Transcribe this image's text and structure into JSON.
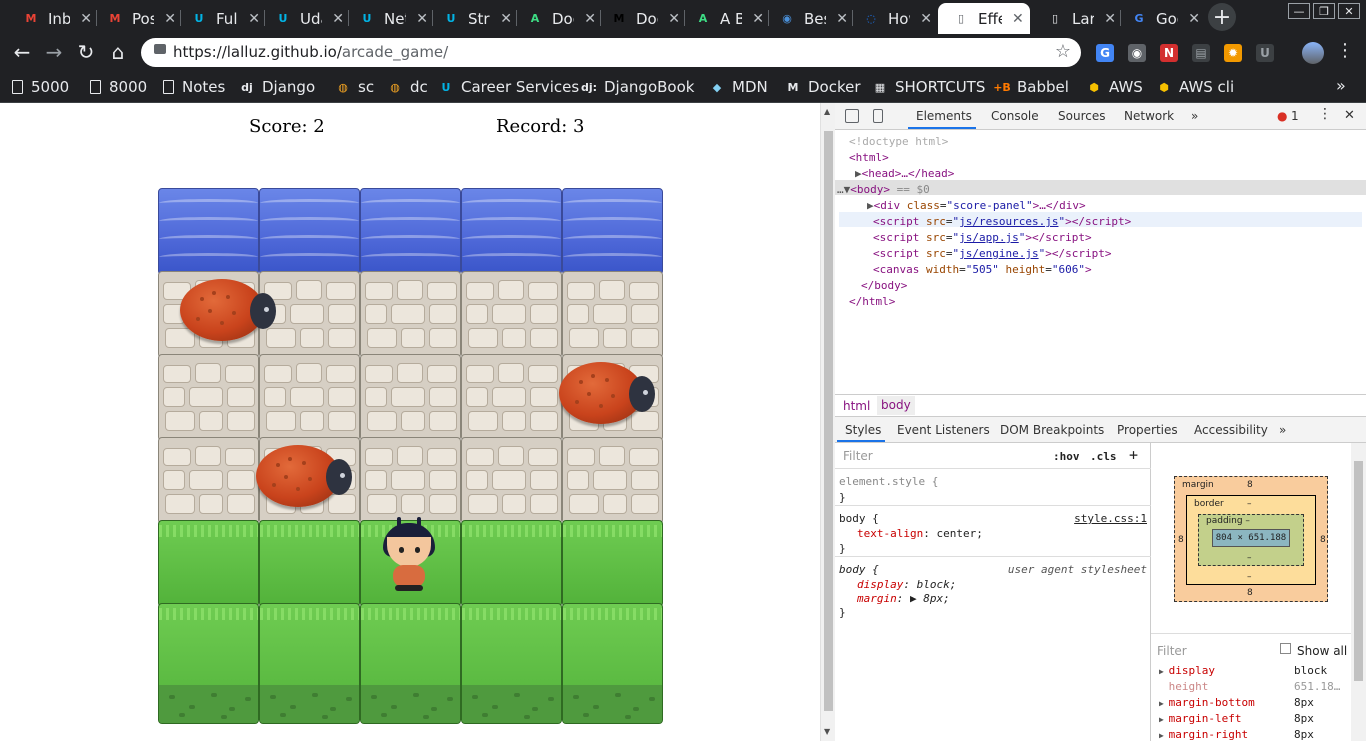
{
  "tabs": [
    {
      "title": "Inbox",
      "icon": "gmail-icon",
      "color": "#ea4335",
      "glyph": "M"
    },
    {
      "title": "Posts",
      "icon": "gmail-icon",
      "color": "#ea4335",
      "glyph": "M"
    },
    {
      "title": "Full",
      "icon": "udacity-icon",
      "color": "#02b3e4",
      "glyph": "U"
    },
    {
      "title": "Udacity",
      "icon": "udacity-icon",
      "color": "#02b3e4",
      "glyph": "U"
    },
    {
      "title": "Net",
      "icon": "udacity-icon",
      "color": "#02b3e4",
      "glyph": "U"
    },
    {
      "title": "Structure",
      "icon": "udacity-icon",
      "color": "#02b3e4",
      "glyph": "U"
    },
    {
      "title": "Docs",
      "icon": "android-icon",
      "color": "#3ddc84",
      "glyph": "A"
    },
    {
      "title": "Docker",
      "icon": "medium-icon",
      "color": "#000000",
      "glyph": "M"
    },
    {
      "title": "A B",
      "icon": "android-icon",
      "color": "#3ddc84",
      "glyph": "A"
    },
    {
      "title": "Best",
      "icon": "globe-icon",
      "color": "#4a90d9",
      "glyph": "◉"
    },
    {
      "title": "How",
      "icon": "loader-icon",
      "color": "#1a73e8",
      "glyph": "◌"
    },
    {
      "title": "Effective",
      "icon": "document-icon",
      "color": "#5f6368",
      "glyph": "▯"
    },
    {
      "title": "Large",
      "icon": "document-icon",
      "color": "#e8eaed",
      "glyph": "▯"
    },
    {
      "title": "Google",
      "icon": "google-icon",
      "color": "#4285f4",
      "glyph": "G"
    }
  ],
  "new_tab_glyph": "+",
  "window": {
    "minimize": "—",
    "maximize": "❐",
    "close": "✕"
  },
  "omnibox": {
    "host": "https://lalluz.github.io/",
    "path": "arcade_game/"
  },
  "bookmarks": [
    {
      "label": "5000",
      "icon": "page-icon"
    },
    {
      "label": "8000",
      "icon": "page-icon"
    },
    {
      "label": "Notes",
      "icon": "page-icon"
    },
    {
      "label": "Django",
      "icon": "django-icon",
      "glyph": "dj"
    },
    {
      "label": "sc",
      "icon": "sc-icon",
      "glyph": "◍"
    },
    {
      "label": "dc",
      "icon": "dc-icon",
      "glyph": "◍"
    },
    {
      "label": "Career Services",
      "icon": "udacity-icon",
      "glyph": "U"
    },
    {
      "label": "DjangoBook",
      "icon": "djangobook-icon",
      "glyph": "dj:"
    },
    {
      "label": "MDN",
      "icon": "mdn-icon",
      "glyph": "◆"
    },
    {
      "label": "Docker",
      "icon": "medium-icon",
      "glyph": "M"
    },
    {
      "label": "SHORTCUTS",
      "icon": "grid-icon",
      "glyph": "▦"
    },
    {
      "label": "Babbel",
      "icon": "babbel-icon",
      "glyph": "+B"
    },
    {
      "label": "AWS",
      "icon": "aws-icon",
      "glyph": "⬢"
    },
    {
      "label": "AWS cli",
      "icon": "aws-icon",
      "glyph": "⬢"
    }
  ],
  "game": {
    "score_label": "Score: 2",
    "record_label": "Record: 3",
    "rows": [
      "water",
      "stone",
      "stone",
      "stone",
      "grass",
      "grass"
    ],
    "enemies": [
      {
        "row": 1,
        "col": 0.2
      },
      {
        "row": 2,
        "col": 3.95
      },
      {
        "row": 3,
        "col": 0.95
      }
    ],
    "player": {
      "row": 4,
      "col": 2
    }
  },
  "devtools": {
    "tabs": [
      "Elements",
      "Console",
      "Sources",
      "Network"
    ],
    "more": "»",
    "error_count": "1",
    "close": "✕",
    "kebab": "⋮",
    "dom": {
      "doctype": "<!doctype html>",
      "html_open": "<html>",
      "head": "<head>…</head>",
      "body_open": "<body>",
      "body_marker": "== $0",
      "div_class": "score-panel",
      "scripts": [
        "js/resources.js",
        "js/app.js",
        "js/engine.js"
      ],
      "canvas_width": "505",
      "canvas_height": "606",
      "body_close": "</body>",
      "html_close": "</html>"
    },
    "breadcrumbs": [
      "html",
      "body"
    ],
    "subtabs": [
      "Styles",
      "Event Listeners",
      "DOM Breakpoints",
      "Properties",
      "Accessibility",
      "»"
    ],
    "filter_placeholder": "Filter",
    "hov": ":hov",
    "cls": ".cls",
    "plus": "+",
    "rules": {
      "element_style": "element.style {",
      "close_brace": "}",
      "body1_selector": "body {",
      "body1_source": "style.css:1",
      "body1_prop": "text-align",
      "body1_val": "center;",
      "body2_selector": "body {",
      "body2_source": "user agent stylesheet",
      "body2_prop1": "display",
      "body2_val1": "block;",
      "body2_prop2": "margin",
      "body2_val2": "8px;"
    },
    "box_model": {
      "margin_label": "margin",
      "margin_value": "8",
      "border_label": "border",
      "border_value": "–",
      "padding_label": "padding –",
      "content": "804 × 651.188",
      "side_dash": "–",
      "side_margin": "8"
    },
    "computed_filter": "Filter",
    "show_all": "Show all",
    "computed": [
      {
        "prop": "display",
        "value": "block"
      },
      {
        "prop": "height",
        "value": "651.18…"
      },
      {
        "prop": "margin-bottom",
        "value": "8px"
      },
      {
        "prop": "margin-left",
        "value": "8px"
      },
      {
        "prop": "margin-right",
        "value": "8px"
      }
    ]
  }
}
